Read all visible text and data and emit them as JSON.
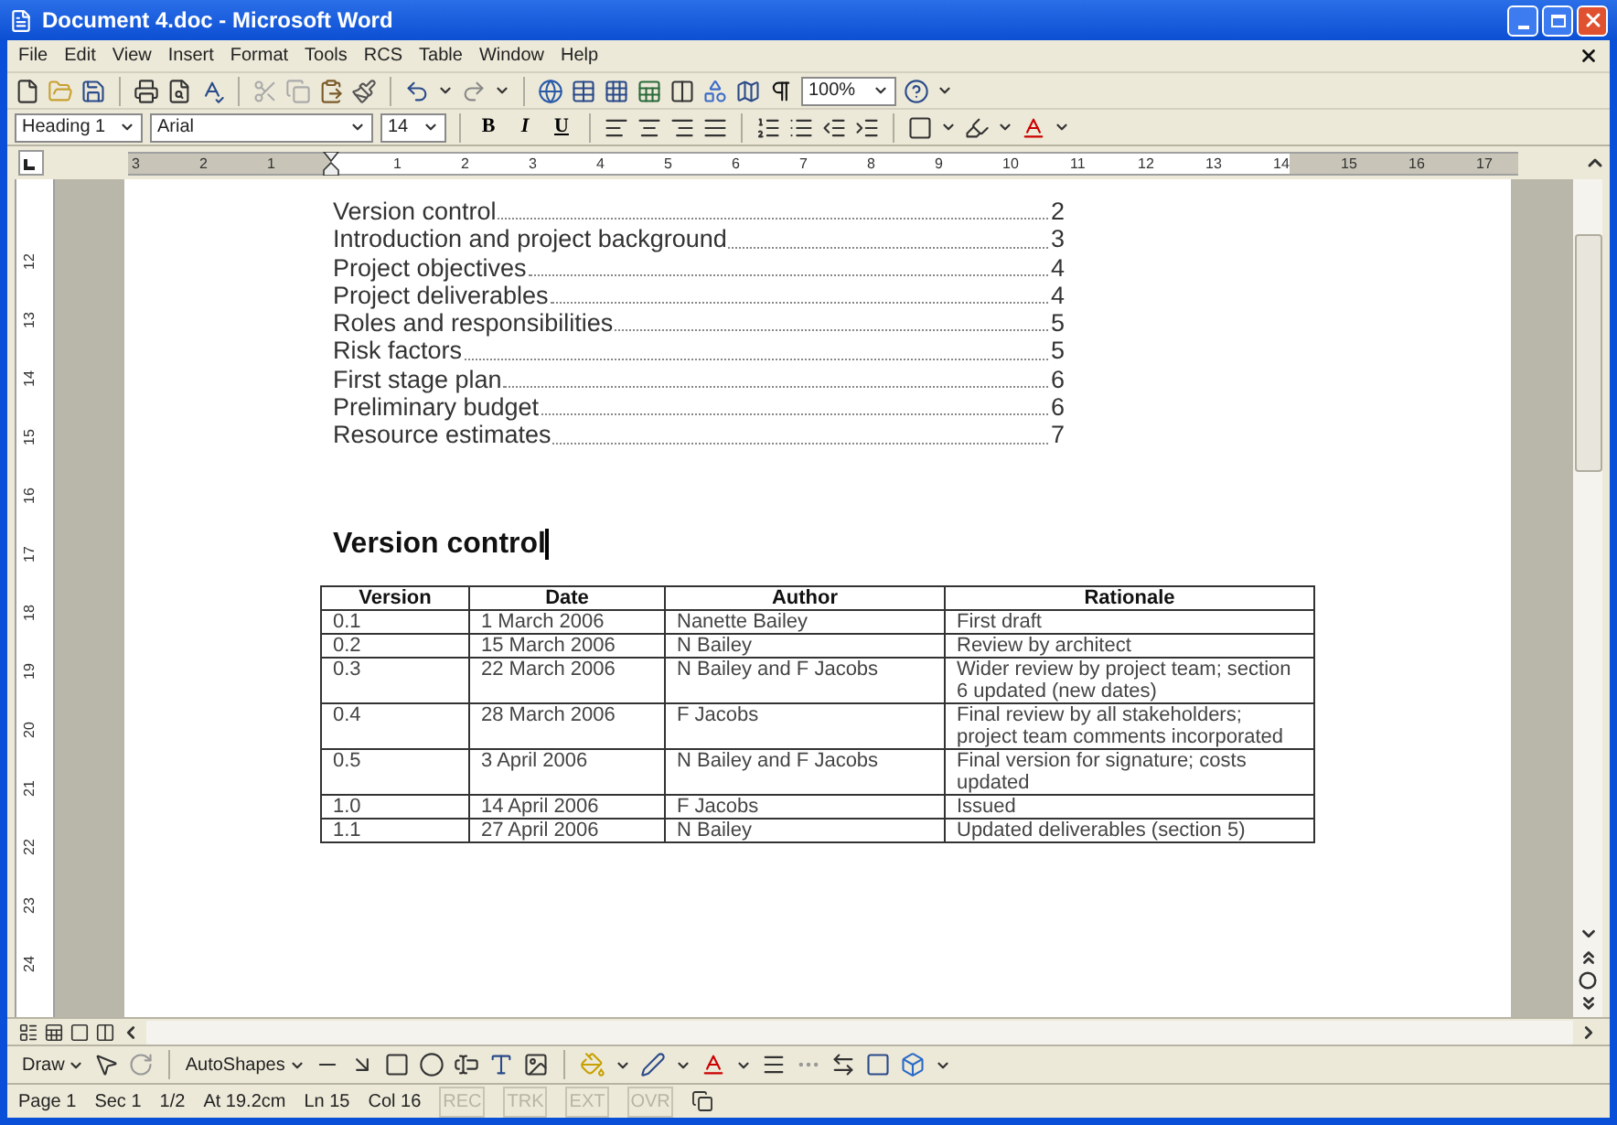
{
  "window": {
    "title": "Document 4.doc - Microsoft Word"
  },
  "menu": [
    "File",
    "Edit",
    "View",
    "Insert",
    "Format",
    "Tools",
    "RCS",
    "Table",
    "Window",
    "Help"
  ],
  "standard_toolbar": {
    "zoom": "100%"
  },
  "formatting_toolbar": {
    "style": "Heading 1",
    "font": "Arial",
    "size": "14",
    "bold": "B",
    "italic": "I",
    "underline": "U"
  },
  "horizontal_ruler": {
    "left_labels": [
      "3",
      "2",
      "1"
    ],
    "right_labels": [
      "1",
      "2",
      "3",
      "4",
      "5",
      "6",
      "7",
      "8",
      "9",
      "10",
      "11",
      "12",
      "13",
      "14",
      "15",
      "16",
      "17"
    ]
  },
  "vertical_ruler": {
    "labels": [
      "12",
      "13",
      "14",
      "15",
      "16",
      "17",
      "18",
      "19",
      "20",
      "21",
      "22",
      "23",
      "24"
    ]
  },
  "document": {
    "toc": [
      {
        "title": "Version control",
        "page": "2"
      },
      {
        "title": "Introduction and project background",
        "page": "3"
      },
      {
        "title": "Project objectives",
        "page": "4"
      },
      {
        "title": "Project deliverables",
        "page": "4"
      },
      {
        "title": "Roles and responsibilities",
        "page": "5"
      },
      {
        "title": "Risk factors",
        "page": "5"
      },
      {
        "title": "First stage plan",
        "page": "6"
      },
      {
        "title": "Preliminary budget",
        "page": "6"
      },
      {
        "title": "Resource estimates",
        "page": "7"
      }
    ],
    "heading": "Version control",
    "table": {
      "columns": [
        "Version",
        "Date",
        "Author",
        "Rationale"
      ],
      "rows": [
        [
          "0.1",
          "1 March 2006",
          "Nanette Bailey",
          "First draft"
        ],
        [
          "0.2",
          "15 March 2006",
          "N Bailey",
          "Review by architect"
        ],
        [
          "0.3",
          "22 March 2006",
          "N Bailey and F Jacobs",
          "Wider review by project team; section 6 updated (new dates)"
        ],
        [
          "0.4",
          "28 March 2006",
          "F Jacobs",
          "Final review by all stakeholders; project team comments incorporated"
        ],
        [
          "0.5",
          "3 April 2006",
          "N Bailey and F Jacobs",
          "Final version for signature; costs updated"
        ],
        [
          "1.0",
          "14 April 2006",
          "F Jacobs",
          "Issued"
        ],
        [
          "1.1",
          "27 April 2006",
          "N Bailey",
          "Updated deliverables (section 5)"
        ]
      ]
    }
  },
  "drawing_toolbar": {
    "draw": "Draw",
    "autoshapes": "AutoShapes"
  },
  "status_bar": {
    "fields": [
      {
        "text": "Page 1",
        "disabled": false
      },
      {
        "text": "Sec 1",
        "disabled": false
      },
      {
        "text": "1/2",
        "disabled": false
      },
      {
        "text": "At 19.2cm",
        "disabled": false
      },
      {
        "text": "Ln 15",
        "disabled": false
      },
      {
        "text": "Col 16",
        "disabled": false
      },
      {
        "text": "REC",
        "disabled": true
      },
      {
        "text": "TRK",
        "disabled": true
      },
      {
        "text": "EXT",
        "disabled": true
      },
      {
        "text": "OVR",
        "disabled": true
      }
    ]
  }
}
